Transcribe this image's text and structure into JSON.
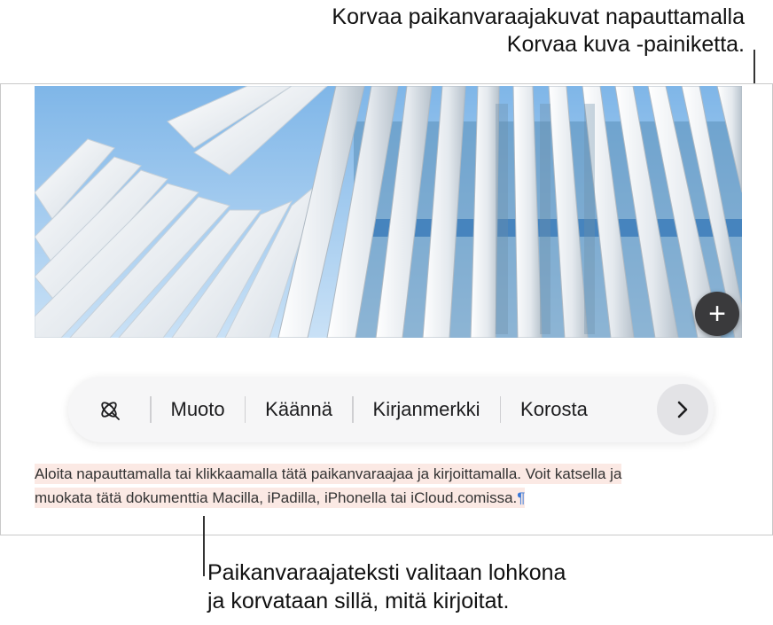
{
  "callouts": {
    "top_line1": "Korvaa paikanvaraajakuvat napauttamalla",
    "top_line2": "Korvaa kuva -painiketta.",
    "bottom_line1": "Paikanvaraajateksti valitaan lohkona",
    "bottom_line2": "ja korvataan sillä, mitä kirjoitat."
  },
  "image": {
    "replace_button_symbol": "+",
    "replace_button_icon": "plus-icon"
  },
  "toolbar": {
    "ai_icon": "writing-tools-icon",
    "items": [
      "Muoto",
      "Käännä",
      "Kirjanmerkki",
      "Korosta"
    ],
    "next_icon": "chevron-right-icon"
  },
  "document": {
    "paragraph_line1": "Aloita napauttamalla tai klikkaamalla tätä paikanvaraajaa ja kirjoittamalla. Voit katsella ja",
    "paragraph_line2": "muokata tätä dokumenttia Macilla, iPadilla, iPhonella tai iCloud.comissa.",
    "pilcrow": "¶"
  },
  "colors": {
    "highlight": "#fbe9e4",
    "pilcrow": "#3a79d8",
    "sky": "#9cc8ef"
  }
}
